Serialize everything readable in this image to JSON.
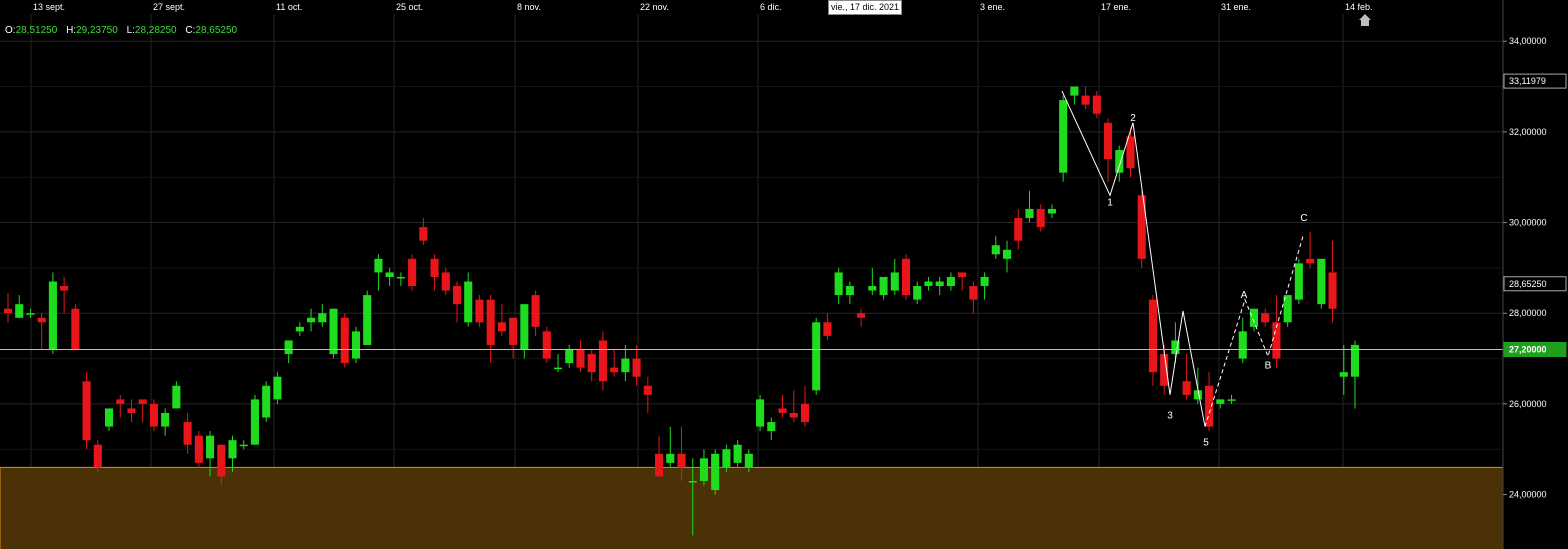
{
  "chart_data": {
    "type": "candlestick",
    "x_axis_labels": [
      "13 sept.",
      "27 sept.",
      "11 oct.",
      "25 oct.",
      "8 nov.",
      "22 nov.",
      "6 dic.",
      "3 ene.",
      "17 ene.",
      "31 ene.",
      "14 feb."
    ],
    "y_ticks": [
      "34,00000",
      "32,00000",
      "30,00000",
      "28,00000",
      "26,00000",
      "24,00000"
    ],
    "ylim": [
      22.8,
      34.6
    ],
    "price_labels": [
      {
        "text": "33,11979",
        "value": 33.12,
        "style": "white"
      },
      {
        "text": "28,65250",
        "value": 28.65,
        "style": "white"
      },
      {
        "text": "27,20000",
        "value": 27.2,
        "style": "green"
      }
    ],
    "crosshair_price": 27.2,
    "crosshair_date_tooltip": "vie., 17 dic. 2021",
    "ohlc": {
      "o_label": "O:",
      "o": "28,51250",
      "h_label": "H:",
      "h": "29,23750",
      "l_label": "L:",
      "l": "28,28250",
      "c_label": "C:",
      "c": "28,65250"
    },
    "support_zone": [
      22.6,
      24.6
    ],
    "colors": {
      "up": "#1fdc1f",
      "down": "#e8161a",
      "zone": "#4a3206",
      "zone_line": "#e08a1e",
      "grid": "#262626"
    },
    "candles": [
      [
        28.1,
        28.45,
        28.0,
        27.8
      ],
      [
        27.9,
        28.4,
        28.2,
        27.9
      ],
      [
        28.0,
        28.1,
        28.0,
        27.9
      ],
      [
        27.9,
        28.0,
        27.8,
        27.2
      ],
      [
        27.2,
        28.9,
        28.7,
        27.1
      ],
      [
        28.6,
        28.8,
        28.5,
        28.0
      ],
      [
        28.1,
        28.2,
        27.2,
        27.2
      ],
      [
        26.5,
        26.7,
        25.2,
        25.0
      ],
      [
        25.1,
        25.2,
        24.6,
        24.5
      ],
      [
        25.5,
        25.9,
        25.9,
        25.4
      ],
      [
        26.1,
        26.2,
        26.0,
        25.7
      ],
      [
        25.9,
        26.1,
        25.8,
        25.6
      ],
      [
        26.1,
        26.1,
        26.0,
        25.6
      ],
      [
        26.0,
        26.1,
        25.5,
        25.4
      ],
      [
        25.5,
        25.9,
        25.8,
        25.3
      ],
      [
        25.9,
        26.5,
        26.4,
        25.9
      ],
      [
        25.6,
        25.8,
        25.1,
        24.9
      ],
      [
        25.3,
        25.4,
        24.7,
        24.6
      ],
      [
        24.8,
        25.4,
        25.3,
        24.4
      ],
      [
        25.1,
        25.1,
        24.4,
        24.2
      ],
      [
        24.8,
        25.3,
        25.2,
        24.5
      ],
      [
        25.1,
        25.2,
        25.1,
        25.0
      ],
      [
        25.1,
        26.2,
        26.1,
        25.1
      ],
      [
        25.7,
        26.5,
        26.4,
        25.6
      ],
      [
        26.1,
        26.7,
        26.6,
        26.0
      ],
      [
        27.1,
        27.4,
        27.4,
        26.9
      ],
      [
        27.6,
        27.8,
        27.7,
        27.5
      ],
      [
        27.8,
        28.1,
        27.9,
        27.6
      ],
      [
        27.8,
        28.2,
        28.0,
        27.7
      ],
      [
        27.1,
        28.1,
        28.1,
        27.0
      ],
      [
        27.9,
        28.0,
        26.9,
        26.8
      ],
      [
        27.0,
        27.7,
        27.6,
        26.9
      ],
      [
        27.3,
        28.5,
        28.4,
        27.3
      ],
      [
        28.9,
        29.3,
        29.2,
        28.5
      ],
      [
        28.8,
        29.0,
        28.9,
        28.6
      ],
      [
        28.8,
        28.9,
        28.8,
        28.6
      ],
      [
        29.2,
        29.3,
        28.6,
        28.5
      ],
      [
        29.9,
        30.1,
        29.6,
        29.5
      ],
      [
        29.2,
        29.3,
        28.8,
        28.5
      ],
      [
        28.9,
        29.0,
        28.5,
        28.4
      ],
      [
        28.6,
        28.7,
        28.2,
        27.8
      ],
      [
        27.8,
        28.9,
        28.7,
        27.7
      ],
      [
        28.3,
        28.4,
        27.8,
        27.7
      ],
      [
        28.3,
        28.4,
        27.3,
        26.9
      ],
      [
        27.8,
        28.2,
        27.6,
        27.5
      ],
      [
        27.9,
        27.9,
        27.3,
        27.0
      ],
      [
        27.2,
        28.2,
        28.2,
        27.0
      ],
      [
        28.4,
        28.5,
        27.7,
        27.5
      ],
      [
        27.6,
        27.7,
        27.0,
        26.9
      ],
      [
        26.8,
        27.1,
        26.8,
        26.7
      ],
      [
        26.9,
        27.3,
        27.2,
        26.8
      ],
      [
        27.2,
        27.4,
        26.8,
        26.7
      ],
      [
        27.1,
        27.2,
        26.7,
        26.5
      ],
      [
        27.4,
        27.6,
        26.5,
        26.3
      ],
      [
        26.8,
        27.2,
        26.7,
        26.6
      ],
      [
        26.7,
        27.3,
        27.0,
        26.5
      ],
      [
        27.0,
        27.3,
        26.6,
        26.4
      ],
      [
        26.4,
        26.6,
        26.2,
        25.8
      ],
      [
        24.9,
        25.3,
        24.4,
        24.4
      ],
      [
        24.7,
        25.5,
        24.9,
        24.6
      ],
      [
        24.9,
        25.5,
        24.6,
        24.3
      ],
      [
        24.3,
        24.8,
        24.3,
        23.1
      ],
      [
        24.3,
        25.0,
        24.8,
        24.2
      ],
      [
        24.1,
        25.0,
        24.9,
        24.0
      ],
      [
        24.6,
        25.1,
        25.0,
        24.5
      ],
      [
        24.7,
        25.2,
        25.1,
        24.6
      ],
      [
        24.6,
        25.0,
        24.9,
        24.5
      ],
      [
        25.5,
        26.2,
        26.1,
        25.4
      ],
      [
        25.4,
        25.7,
        25.6,
        25.2
      ],
      [
        25.9,
        26.2,
        25.8,
        25.7
      ],
      [
        25.8,
        26.3,
        25.7,
        25.6
      ],
      [
        26.0,
        26.4,
        25.6,
        25.5
      ],
      [
        26.3,
        27.9,
        27.8,
        26.2
      ],
      [
        27.8,
        28.0,
        27.5,
        27.4
      ],
      [
        28.4,
        29.0,
        28.9,
        28.2
      ],
      [
        28.4,
        28.7,
        28.6,
        28.2
      ],
      [
        28.0,
        28.1,
        27.9,
        27.7
      ],
      [
        28.5,
        29.0,
        28.6,
        28.4
      ],
      [
        28.4,
        28.7,
        28.8,
        28.3
      ],
      [
        28.5,
        29.2,
        28.9,
        28.4
      ],
      [
        29.2,
        29.3,
        28.4,
        28.3
      ],
      [
        28.3,
        28.7,
        28.6,
        28.2
      ],
      [
        28.6,
        28.8,
        28.7,
        28.5
      ],
      [
        28.6,
        28.8,
        28.7,
        28.4
      ],
      [
        28.6,
        28.9,
        28.8,
        28.5
      ],
      [
        28.9,
        28.9,
        28.8,
        28.5
      ],
      [
        28.6,
        28.7,
        28.3,
        28.0
      ],
      [
        28.6,
        28.9,
        28.8,
        28.3
      ],
      [
        29.3,
        29.7,
        29.5,
        29.2
      ],
      [
        29.2,
        29.6,
        29.4,
        28.9
      ],
      [
        30.1,
        30.3,
        29.6,
        29.4
      ],
      [
        30.1,
        30.7,
        30.3,
        30.0
      ],
      [
        30.3,
        30.4,
        29.9,
        29.8
      ],
      [
        30.2,
        30.4,
        30.3,
        30.1
      ],
      [
        31.1,
        32.8,
        32.7,
        30.9
      ],
      [
        32.8,
        33.0,
        33.0,
        32.6
      ],
      [
        32.8,
        33.0,
        32.6,
        32.5
      ],
      [
        32.8,
        32.9,
        32.4,
        32.3
      ],
      [
        32.2,
        32.3,
        31.4,
        30.9
      ],
      [
        31.1,
        31.7,
        31.6,
        30.9
      ],
      [
        31.9,
        32.1,
        31.2,
        31.0
      ],
      [
        30.6,
        30.7,
        29.2,
        29.0
      ],
      [
        28.3,
        28.4,
        26.7,
        26.4
      ],
      [
        27.1,
        27.3,
        26.4,
        26.2
      ],
      [
        27.1,
        27.8,
        27.4,
        26.9
      ],
      [
        26.5,
        27.1,
        26.2,
        26.1
      ],
      [
        26.1,
        26.8,
        26.3,
        26.0
      ],
      [
        26.4,
        26.7,
        25.5,
        25.4
      ],
      [
        26.0,
        26.1,
        26.1,
        25.9
      ],
      [
        26.1,
        26.2,
        26.1,
        26.0
      ],
      [
        27.0,
        27.9,
        27.6,
        26.9
      ],
      [
        27.7,
        28.0,
        28.1,
        27.6
      ],
      [
        28.0,
        28.1,
        27.8,
        27.7
      ],
      [
        27.8,
        28.4,
        27.0,
        26.8
      ],
      [
        27.8,
        28.4,
        28.4,
        27.7
      ],
      [
        28.3,
        29.2,
        29.1,
        28.2
      ],
      [
        29.2,
        29.8,
        29.1,
        29.0
      ],
      [
        28.2,
        29.2,
        29.2,
        28.1
      ],
      [
        28.9,
        29.6,
        28.1,
        27.8
      ],
      [
        26.6,
        27.3,
        26.7,
        26.2
      ],
      [
        26.6,
        27.4,
        27.3,
        25.9
      ]
    ],
    "wave_labels": [
      {
        "text": "1",
        "value": 30.55
      },
      {
        "text": "2",
        "value": 32.15
      },
      {
        "text": "3",
        "value": 25.9
      },
      {
        "text": "5",
        "value": 25.3
      },
      {
        "text": "A",
        "value": 28.25
      },
      {
        "text": "B",
        "value": 27.0
      },
      {
        "text": "C",
        "value": 29.95
      }
    ]
  }
}
